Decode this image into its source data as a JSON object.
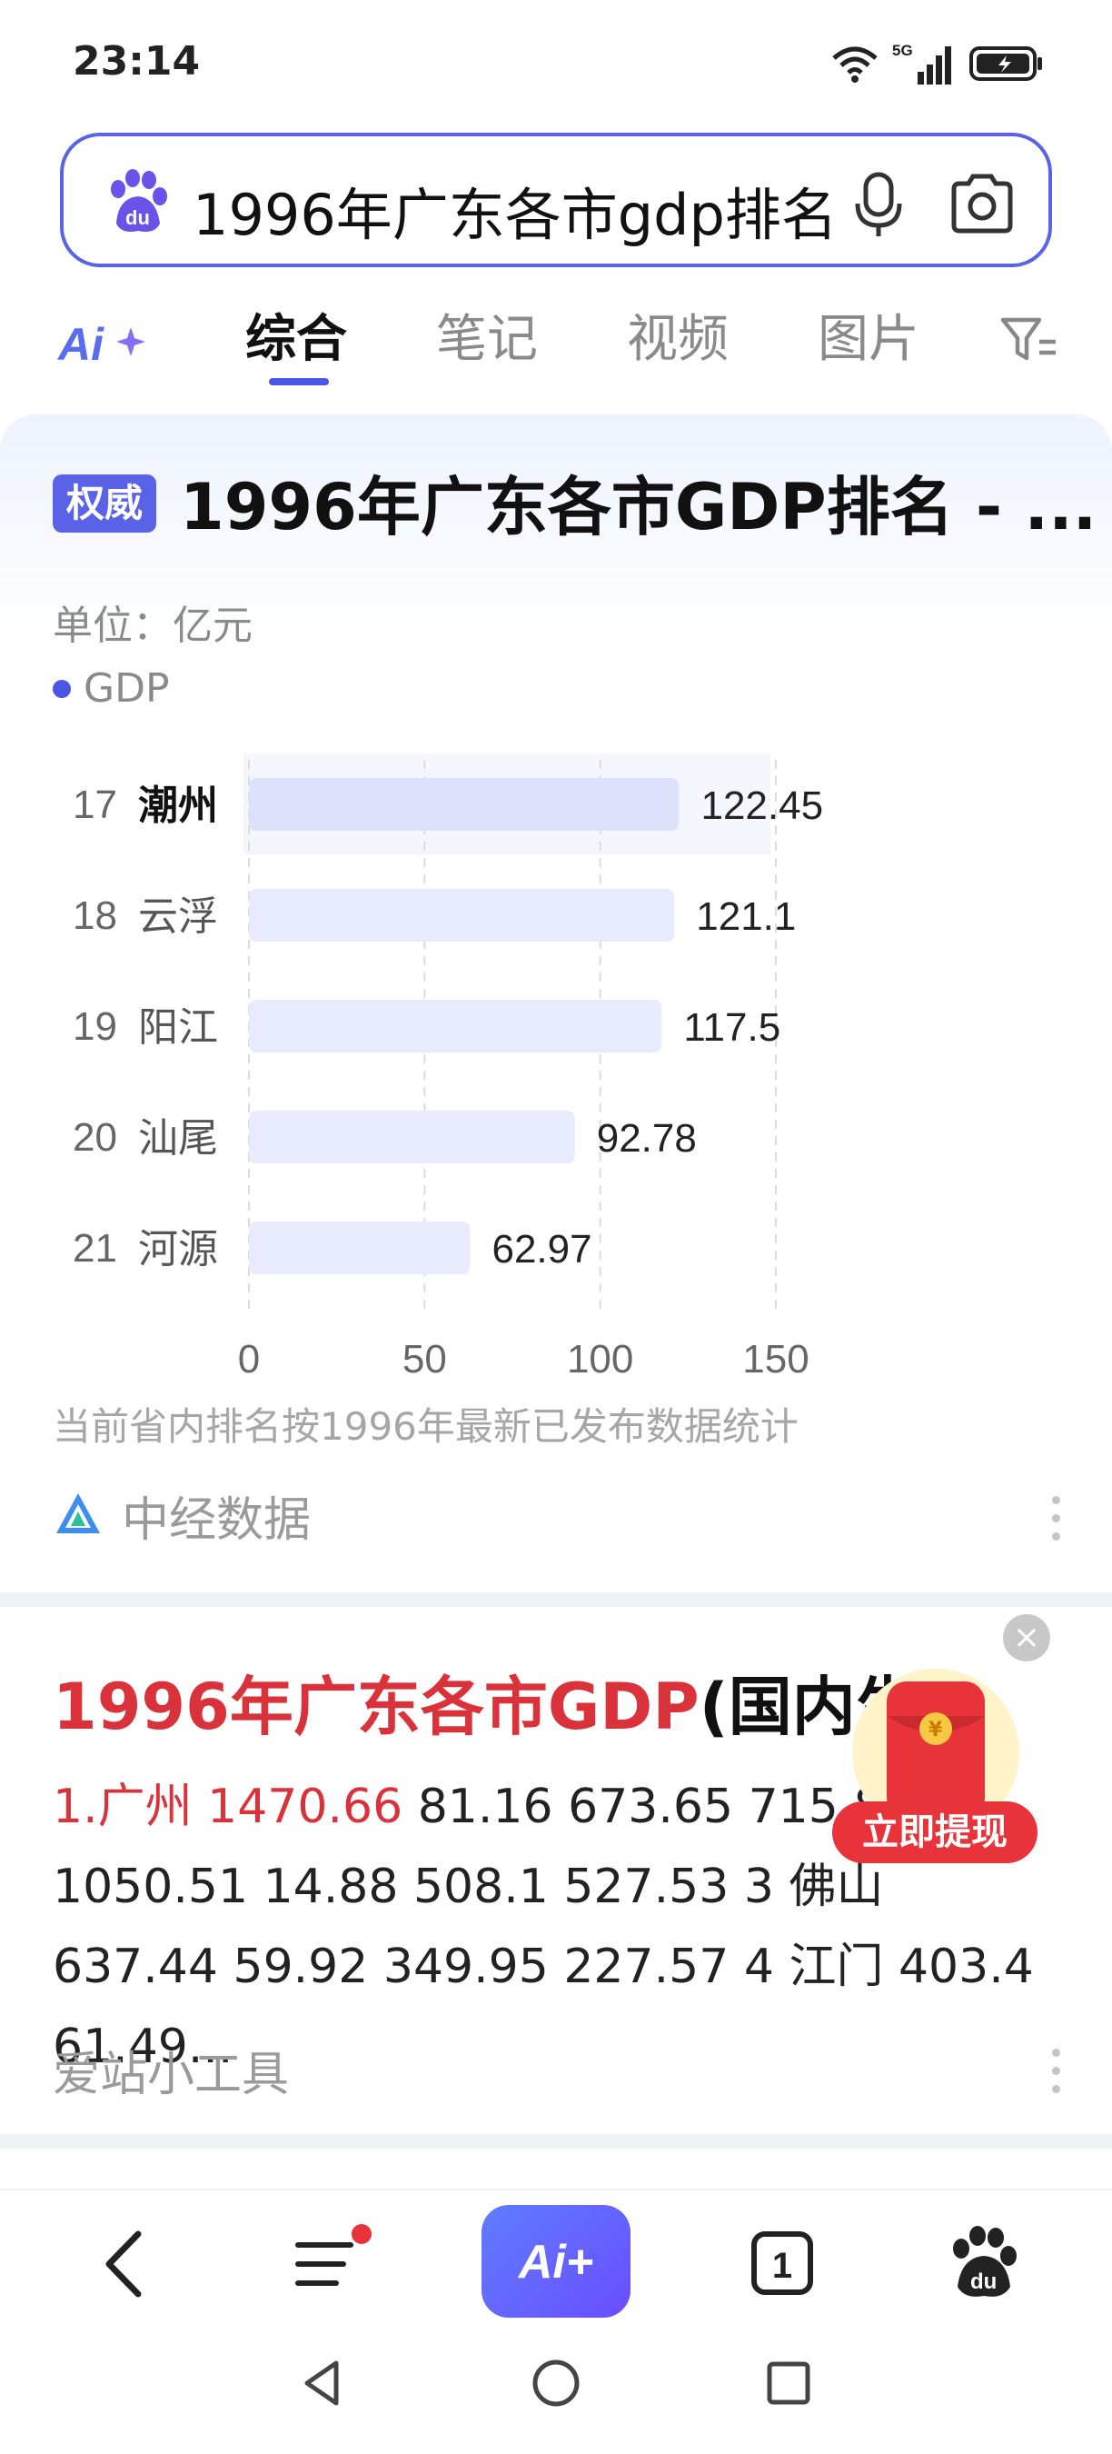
{
  "status_bar": {
    "time": "23:14",
    "network": "5G"
  },
  "search": {
    "query": "1996年广东各市gdp排名"
  },
  "tabs": [
    {
      "label": "综合",
      "active": true
    },
    {
      "label": "笔记",
      "active": false
    },
    {
      "label": "视频",
      "active": false
    },
    {
      "label": "图片",
      "active": false
    }
  ],
  "card1": {
    "badge": "权威",
    "title": "1996年广东各市GDP排名 - ...",
    "unit": "单位：亿元",
    "legend": "GDP",
    "footnote": "当前省内排名按1996年最新已发布数据统计",
    "source": "中经数据"
  },
  "chart_data": {
    "type": "bar",
    "orientation": "horizontal",
    "ranks": [
      "17",
      "18",
      "19",
      "20",
      "21"
    ],
    "categories": [
      "潮州",
      "云浮",
      "阳江",
      "汕尾",
      "河源"
    ],
    "series": [
      {
        "name": "GDP",
        "values": [
          122.45,
          121.1,
          117.5,
          92.78,
          62.97
        ]
      }
    ],
    "value_labels": [
      "122.45",
      "121.1",
      "117.5",
      "92.78",
      "62.97"
    ],
    "xlim": [
      0,
      150
    ],
    "xticks": [
      0,
      50,
      100,
      150
    ],
    "grid": true,
    "highlight_index": 0,
    "colors": {
      "bar": "#e8ebfc",
      "bar_highlight": "#dde2fa",
      "grid": "#dcdcdc"
    }
  },
  "card2": {
    "title_red": "1996年广东各市GDP",
    "title_black": "(国内生产",
    "body_red": "1.广州 1470.66",
    "body_rest": " 81.16 673.65 715.84 ... 1050.51 14.88 508.1 527.53 3 佛山 637.44 59.92 349.95 227.57 4 江门 403.4 61.49...",
    "source": "爱站小工具"
  },
  "float_widget": {
    "cta": "立即提现",
    "close": "×"
  },
  "bottom_nav": {
    "tab_count": "1",
    "ai_label": "Ai+"
  },
  "colors": {
    "accent": "#4b55e6",
    "red": "#d9323a"
  }
}
